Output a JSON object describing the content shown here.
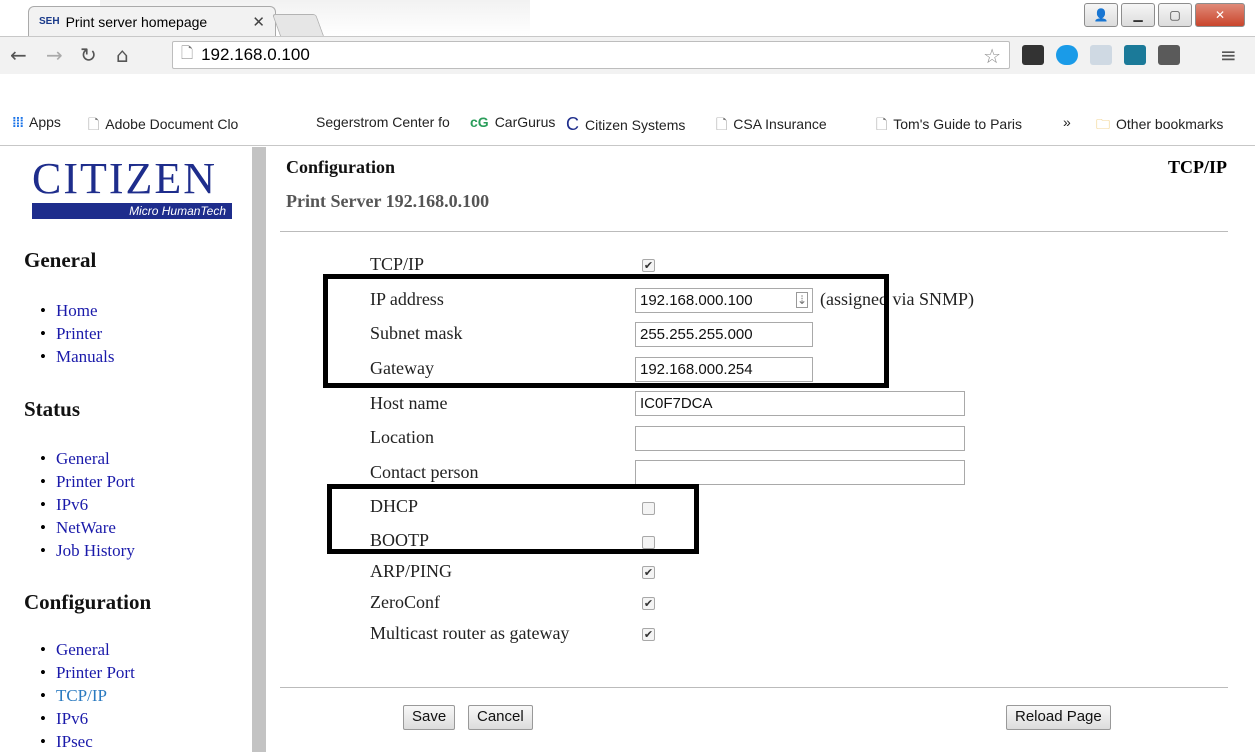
{
  "browser": {
    "tab_title": "Print server homepage",
    "tab_favicon": "SEH",
    "url": "192.168.0.100",
    "bookmarks": [
      "Apps",
      "Adobe Document Clo",
      "Segerstrom Center fo",
      "CarGurus",
      "Citizen Systems",
      "CSA Insurance",
      "Tom's Guide to Paris",
      "»",
      "Other bookmarks"
    ]
  },
  "logo": {
    "brand": "CITIZEN",
    "tagline": "Micro HumanTech"
  },
  "sidebar": {
    "general": {
      "heading": "General",
      "items": [
        "Home",
        "Printer",
        "Manuals"
      ]
    },
    "status": {
      "heading": "Status",
      "items": [
        "General",
        "Printer Port",
        "IPv6",
        "NetWare",
        "Job History"
      ]
    },
    "configuration": {
      "heading": "Configuration",
      "items": [
        "General",
        "Printer Port",
        "TCP/IP",
        "IPv6",
        "IPsec"
      ]
    }
  },
  "main": {
    "title": "Configuration",
    "subtitle": "Print Server 192.168.0.100",
    "section": "TCP/IP",
    "rows": {
      "tcpip": {
        "label": "TCP/IP",
        "checked": true
      },
      "ip": {
        "label": "IP address",
        "value": "192.168.000.100",
        "note": "(assigned via SNMP)"
      },
      "subnet": {
        "label": "Subnet mask",
        "value": "255.255.255.000"
      },
      "gateway": {
        "label": "Gateway",
        "value": "192.168.000.254"
      },
      "host": {
        "label": "Host name",
        "value": "IC0F7DCA"
      },
      "location": {
        "label": "Location",
        "value": ""
      },
      "contact": {
        "label": "Contact person",
        "value": ""
      },
      "dhcp": {
        "label": "DHCP",
        "checked": false
      },
      "bootp": {
        "label": "BOOTP",
        "checked": false
      },
      "arp": {
        "label": "ARP/PING",
        "checked": true
      },
      "zeroconf": {
        "label": "ZeroConf",
        "checked": true
      },
      "multicast": {
        "label": "Multicast router as gateway",
        "checked": true
      }
    },
    "buttons": {
      "save": "Save",
      "cancel": "Cancel",
      "reload": "Reload Page"
    }
  },
  "colors": {
    "brand_blue": "#1e2d8c",
    "link": "#1a1aaa",
    "active_link": "#2a7ac0"
  }
}
